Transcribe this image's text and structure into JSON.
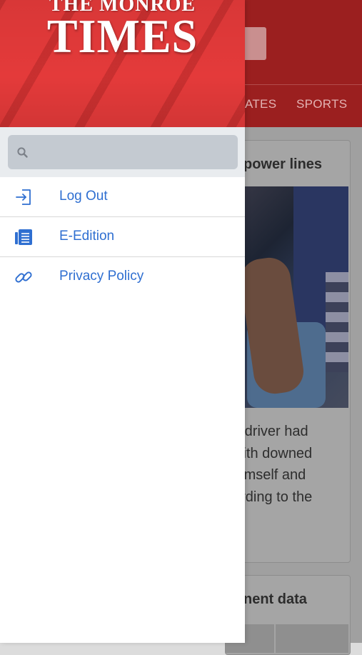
{
  "app": {
    "logo_line1": "THE MONROE",
    "logo_line2": "TIMES"
  },
  "drawer": {
    "search": {
      "placeholder": "",
      "value": ""
    },
    "items": [
      {
        "label": "Log Out",
        "icon": "log-out-icon"
      },
      {
        "label": "E-Edition",
        "icon": "newspaper-icon"
      },
      {
        "label": "Privacy Policy",
        "icon": "link-icon"
      }
    ]
  },
  "background": {
    "nav": [
      "ATES",
      "SPORTS"
    ],
    "card1": {
      "title": "power lines",
      "text_lines": [
        "e driver had",
        "with downed",
        "himself and",
        "ording to the"
      ]
    },
    "card2": {
      "title": "nent data"
    }
  },
  "colors": {
    "accent": "#e43a3a",
    "link": "#2f6fd1",
    "search_bg": "#c4cad1"
  }
}
